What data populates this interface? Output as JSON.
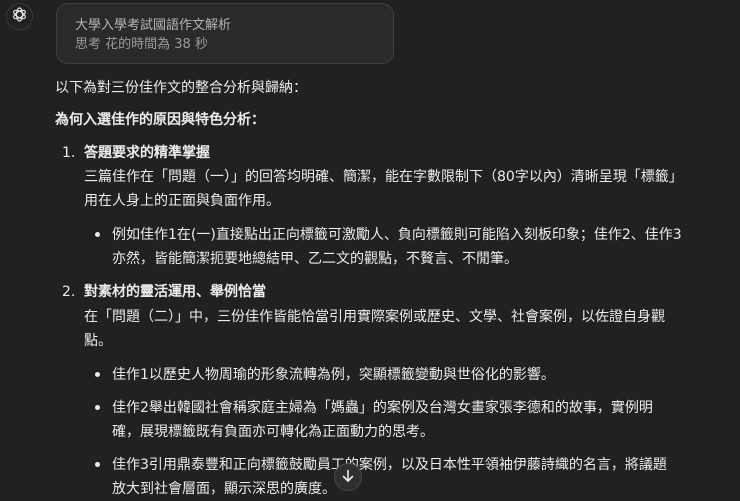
{
  "assistant": {
    "avatar_icon": "openai-logo-icon"
  },
  "thought": {
    "title": "大學入學考試國語作文解析",
    "time": "思考 花的時間為 38 秒"
  },
  "content": {
    "intro": "以下為對三份佳作文的整合分析與歸納：",
    "heading": "為何入選佳作的原因與特色分析：",
    "sections": [
      {
        "number": "1.",
        "title": "答題要求的精準掌握",
        "desc": [
          "三篇佳作在「問題（一）」的回答均明確、簡潔，能在字數限制下（80字以內）清晰呈現「標籤」",
          "用在人身上的正面與負面作用。"
        ],
        "bullets": [
          [
            "例如佳作1在(一)直接點出正向標籤可激勵人、負向標籤則可能陷入刻板印象；佳作2、佳作3",
            "亦然，皆能簡潔扼要地總結甲、乙二文的觀點，不贅言、不閒筆。"
          ]
        ]
      },
      {
        "number": "2.",
        "title": "對素材的靈活運用、舉例恰當",
        "desc": [
          "在「問題（二）」中，三份佳作皆能恰當引用實際案例或歷史、文學、社會案例，以佐證自身觀",
          "點。"
        ],
        "bullets": [
          [
            "佳作1以歷史人物周瑜的形象流轉為例，突顯標籤變動與世俗化的影響。"
          ],
          [
            "佳作2舉出韓國社會稱家庭主婦為「媽蟲」的案例及台灣女畫家張李德和的故事，實例明",
            "確，展現標籤既有負面亦可轉化為正面動力的思考。"
          ],
          [
            "佳作3引用鼎泰豐和正向標籤鼓勵員工的案例，以及日本性平領袖伊藤詩織的名言，將議題",
            "放大到社會層面，顯示深思的廣度。"
          ]
        ]
      }
    ]
  },
  "scroll_button": {
    "icon": "arrow-down-icon"
  }
}
